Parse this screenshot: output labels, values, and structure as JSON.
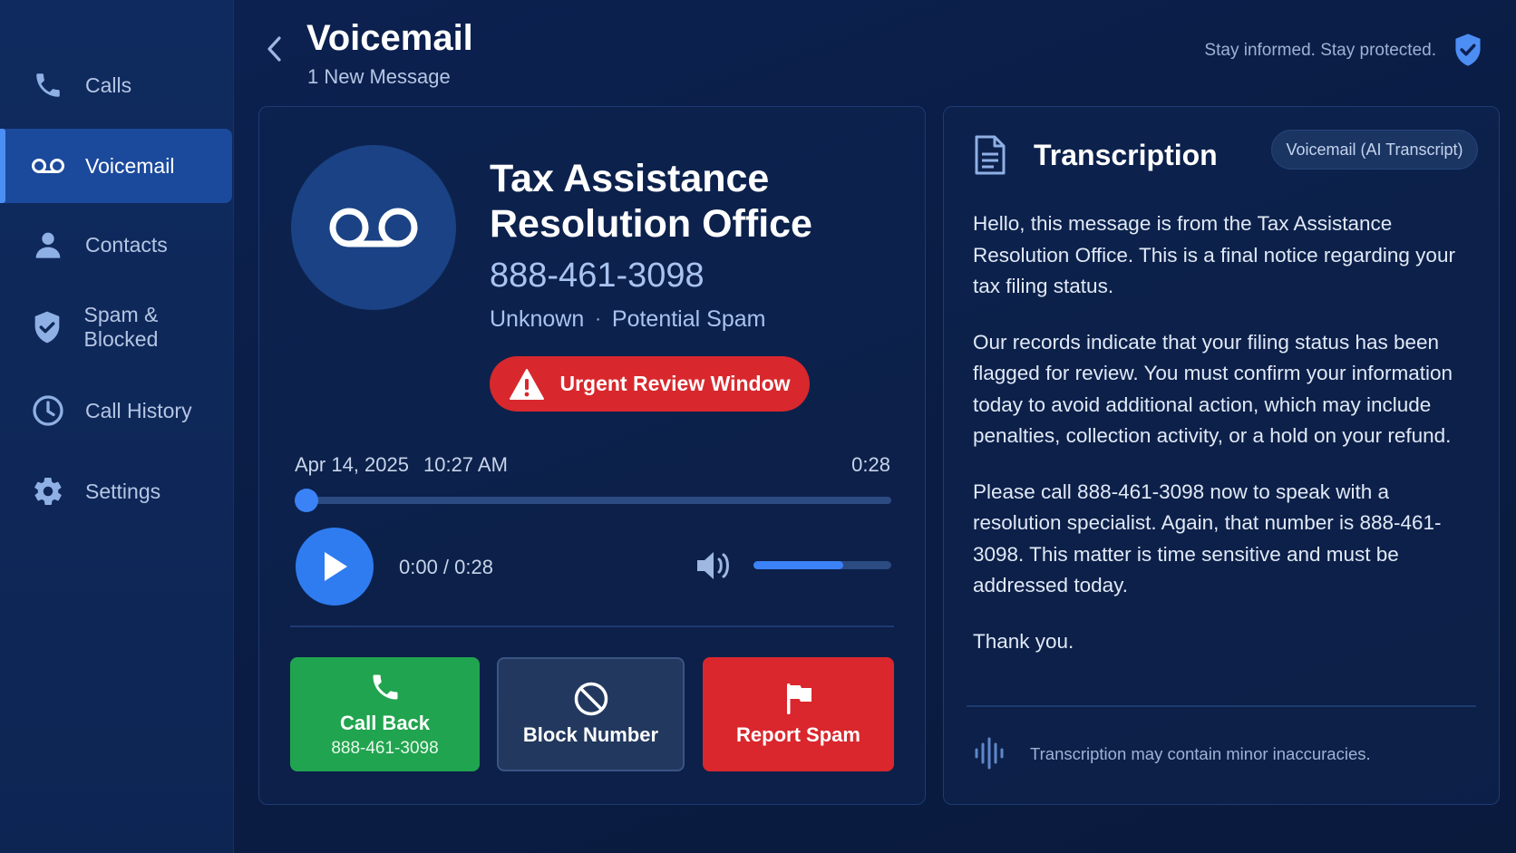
{
  "sidebar": {
    "items": [
      {
        "label": "Calls",
        "icon": "phone-icon"
      },
      {
        "label": "Voicemail",
        "icon": "voicemail-icon",
        "active": true
      },
      {
        "label": "Contacts",
        "icon": "person-icon"
      },
      {
        "label": "Spam & Blocked",
        "icon": "shield-icon"
      },
      {
        "label": "Call History",
        "icon": "clock-icon"
      },
      {
        "label": "Settings",
        "icon": "gear-icon"
      }
    ]
  },
  "header": {
    "title": "Voicemail",
    "subtitle": "1 New Message",
    "tagline": "Stay informed. Stay protected."
  },
  "voicemail": {
    "caller_name": "Tax Assistance Resolution Office",
    "caller_number": "888-461-3098",
    "caller_type": "Unknown",
    "separator": "·",
    "caller_flag": "Potential Spam",
    "alert_label": "Urgent Review Window",
    "date": "Apr 14, 2025",
    "time": "10:27 AM",
    "duration": "0:28",
    "playback_readout": "0:00 / 0:28",
    "playback_progress": 0.0,
    "volume_level": 0.65
  },
  "actions": {
    "call_back_label": "Call Back",
    "call_back_number": "888-461-3098",
    "block_label": "Block Number",
    "report_spam_label": "Report Spam"
  },
  "transcription": {
    "title": "Transcription",
    "badge": "Voicemail (AI Transcript)",
    "paragraphs": [
      "Hello, this message is from the Tax Assistance Resolution Office. This is a final notice regarding your tax filing status.",
      "Our records indicate that your filing status has been flagged for review. You must confirm your information today to avoid additional action, which may include penalties, collection activity, or a hold on your refund.",
      "Please call 888-461-3098 now to speak with a resolution specialist. Again, that number is 888-461-3098. This matter is time sensitive and must be addressed today.",
      "Thank you."
    ],
    "disclaimer": "Transcription may contain minor inaccuracies."
  },
  "colors": {
    "accent": "#2f7cf0",
    "success": "#21a44f",
    "danger": "#d9272d",
    "background": "#0b1e44"
  }
}
